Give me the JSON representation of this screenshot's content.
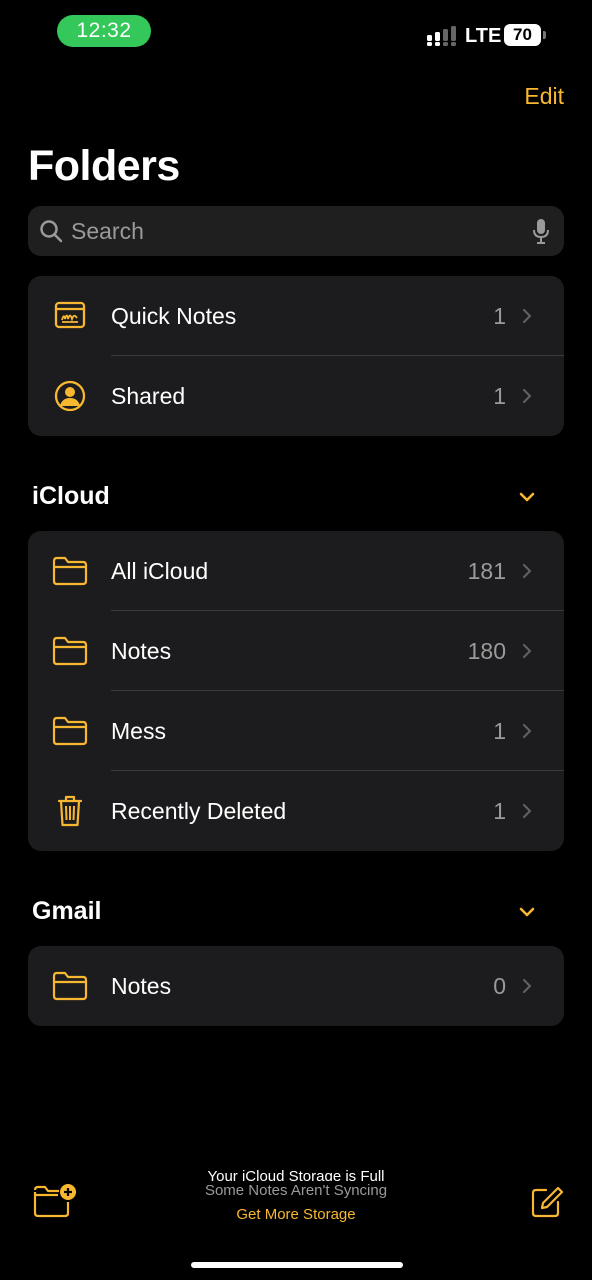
{
  "status_bar": {
    "time": "12:32",
    "network": "LTE",
    "battery": "70"
  },
  "header": {
    "edit_label": "Edit",
    "title": "Folders"
  },
  "search": {
    "placeholder": "Search"
  },
  "pinned_folders": [
    {
      "label": "Quick Notes",
      "count": "1",
      "icon": "quick-notes-icon"
    },
    {
      "label": "Shared",
      "count": "1",
      "icon": "shared-person-icon"
    }
  ],
  "icloud": {
    "title": "iCloud",
    "folders": [
      {
        "label": "All iCloud",
        "count": "181",
        "icon": "folder-icon"
      },
      {
        "label": "Notes",
        "count": "180",
        "icon": "folder-icon"
      },
      {
        "label": "Mess",
        "count": "1",
        "icon": "folder-icon"
      },
      {
        "label": "Recently Deleted",
        "count": "1",
        "icon": "trash-icon"
      }
    ]
  },
  "gmail": {
    "title": "Gmail",
    "folders": [
      {
        "label": "Notes",
        "count": "0",
        "icon": "folder-icon"
      }
    ]
  },
  "bottom_bar": {
    "storage_title": "Your iCloud Storage is Full",
    "storage_subtitle": "Some Notes Aren't Syncing",
    "storage_link": "Get More Storage"
  },
  "colors": {
    "background": "#000000",
    "card": "#1c1c1e",
    "accent": "#f7b731",
    "secondary_text": "#9a9a9a",
    "time_pill": "#34c759"
  }
}
